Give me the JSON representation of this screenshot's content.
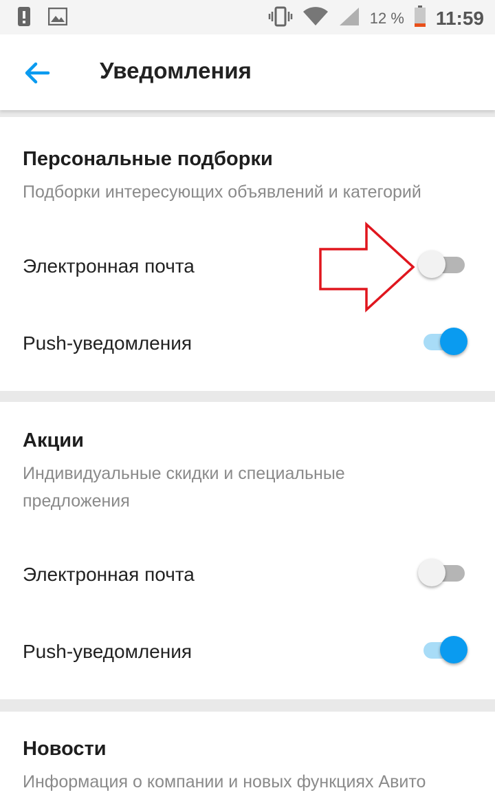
{
  "status_bar": {
    "battery_percent": "12 %",
    "time": "11:59",
    "icons": [
      "alert-icon",
      "image-icon",
      "vibrate-icon",
      "wifi-icon",
      "signal-icon",
      "battery-icon"
    ]
  },
  "app_bar": {
    "title": "Уведомления",
    "back_icon": "arrow-left-icon",
    "accent_color": "#0a9bf0"
  },
  "sections": [
    {
      "title": "Персональные подборки",
      "subtitle": "Подборки интересующих объявлений и категорий",
      "rows": [
        {
          "label": "Электронная почта",
          "enabled": false
        },
        {
          "label": "Push-уведомления",
          "enabled": true
        }
      ]
    },
    {
      "title": "Акции",
      "subtitle": "Индивидуальные скидки и специальные предложения",
      "rows": [
        {
          "label": "Электронная почта",
          "enabled": false
        },
        {
          "label": "Push-уведомления",
          "enabled": true
        }
      ]
    },
    {
      "title": "Новости",
      "subtitle": "Информация о компании и новых функциях Авито"
    }
  ],
  "annotation": {
    "icon": "red-arrow-icon",
    "color": "#e0161e"
  }
}
